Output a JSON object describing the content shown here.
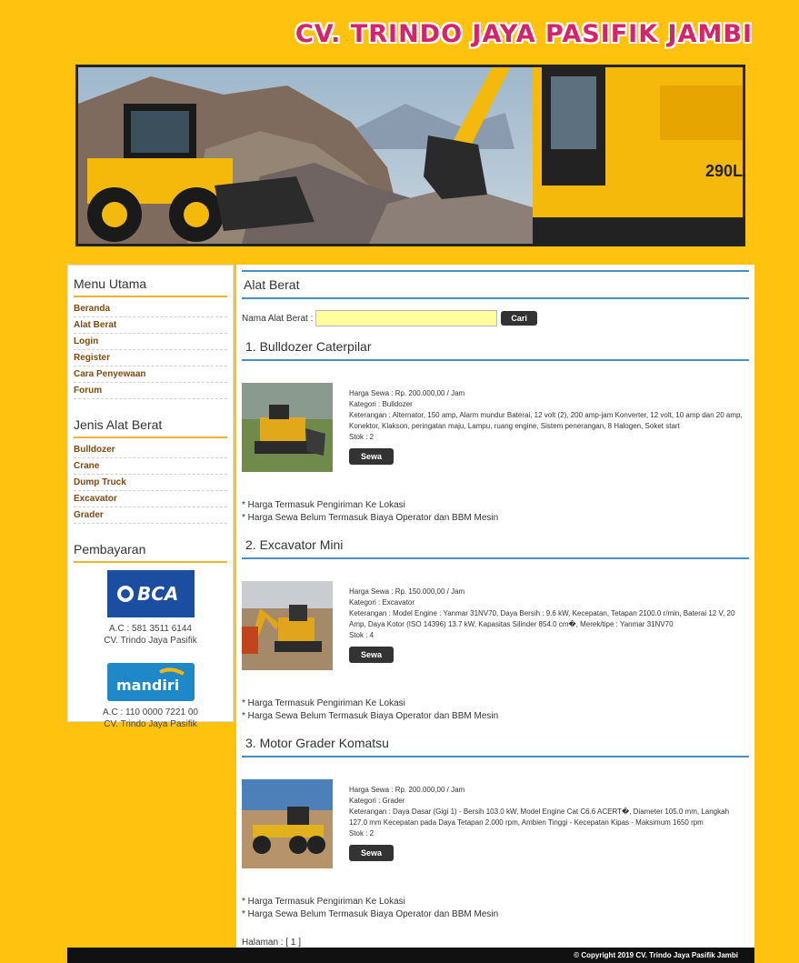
{
  "site": {
    "title": "CV. TRINDO JAYA PASIFIK JAMBI"
  },
  "sidebar": {
    "menu_title": "Menu Utama",
    "menu": [
      "Beranda",
      "Alat Berat",
      "Login",
      "Register",
      "Cara Penyewaan",
      "Forum"
    ],
    "jenis_title": "Jenis Alat Berat",
    "jenis": [
      "Bulldozer",
      "Crane",
      "Dump Truck",
      "Excavator",
      "Grader"
    ],
    "payment_title": "Pembayaran",
    "banks": [
      {
        "logo": "BCA",
        "account": "A.C : 581 3511 6144",
        "holder": "CV. Trindo Jaya Pasifik"
      },
      {
        "logo": "mandiri",
        "account": "A.C : 110 0000 7221 00",
        "holder": "CV. Trindo Jaya Pasifik"
      }
    ]
  },
  "main": {
    "heading": "Alat Berat",
    "search_label": "Nama Alat Berat :",
    "search_value": "",
    "search_button": "Cari",
    "items": [
      {
        "title": "1. Bulldozer Caterpilar",
        "harga": "Harga Sewa : Rp. 200.000,00 / Jam",
        "kategori": "Kategori : Bulldozer",
        "keterangan": "Keterangan : Alternator, 150 amp, Alarm mundur Baterai, 12 volt (2), 200 amp-jam Konverter, 12 volt, 10 amp dan 20 amp, Konektor, Klakson, peringatan maju, Lampu, ruang engine, Sistem penerangan, 8 Halogen, Soket start",
        "stok": "Stok : 2",
        "button": "Sewa",
        "image_icon": "bulldozer-photo"
      },
      {
        "title": "2. Excavator Mini",
        "harga": "Harga Sewa : Rp. 150.000,00 / Jam",
        "kategori": "Kategori : Excavator",
        "keterangan": "Keterangan : Model Engine : Yanmar 31NV70, Daya Bersih : 9.6 kW, Kecepatan, Tetapan 2100.0 r/min, Baterai 12 V, 20 Amp, Daya Kotor (ISO 14396) 13.7 kW, Kapasitas Silinder 854.0 cm�, Merek/tipe : Yanmar 31NV70",
        "stok": "Stok : 4",
        "button": "Sewa",
        "image_icon": "excavator-photo"
      },
      {
        "title": "3. Motor Grader Komatsu",
        "harga": "Harga Sewa : Rp. 200.000,00 / Jam",
        "kategori": "Kategori : Grader",
        "keterangan": "Keterangan : Daya Dasar (Gigi 1) - Bersih 103.0 kW, Model Engine Cat C6.6 ACERT�, Diameter 105.0 mm, Langkah 127.0 mm Kecepatan pada Daya Tetapan 2.000 rpm, Ambien Tinggi - Kecepatan Kipas - Maksimum 1650 rpm",
        "stok": "Stok : 2",
        "button": "Sewa",
        "image_icon": "grader-photo"
      }
    ],
    "note_1": "* Harga Termasuk Pengiriman Ke Lokasi",
    "note_2": "* Harga Sewa Belum Termasuk Biaya Operator dan BBM Mesin",
    "pager": "Halaman : [ 1 ]"
  },
  "footer": {
    "copyright": "© Copyright 2019 CV. Trindo Jaya Pasifik Jambi"
  }
}
